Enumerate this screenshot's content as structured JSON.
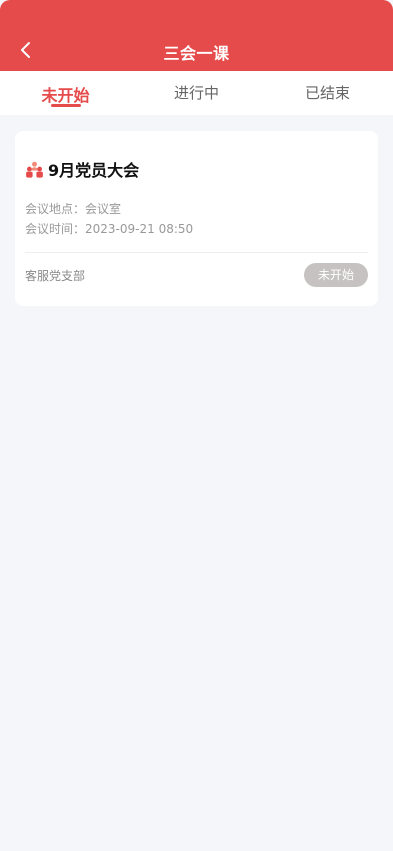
{
  "header": {
    "title": "三会一课",
    "back_icon": "chevron-left-icon"
  },
  "tabs": [
    {
      "label": "未开始",
      "active": true
    },
    {
      "label": "进行中",
      "active": false
    },
    {
      "label": "已结束",
      "active": false
    }
  ],
  "meeting": {
    "icon": "people-group-icon",
    "title": "9月党员大会",
    "location_label": "会议地点：",
    "location": "会议室",
    "time_label": "会议时间：",
    "time": "2023-09-21 08:50",
    "branch": "客服党支部",
    "status": "未开始"
  },
  "colors": {
    "accent": "#e64b4b",
    "background": "#f5f6fa",
    "badge": "#c6c2c2"
  }
}
